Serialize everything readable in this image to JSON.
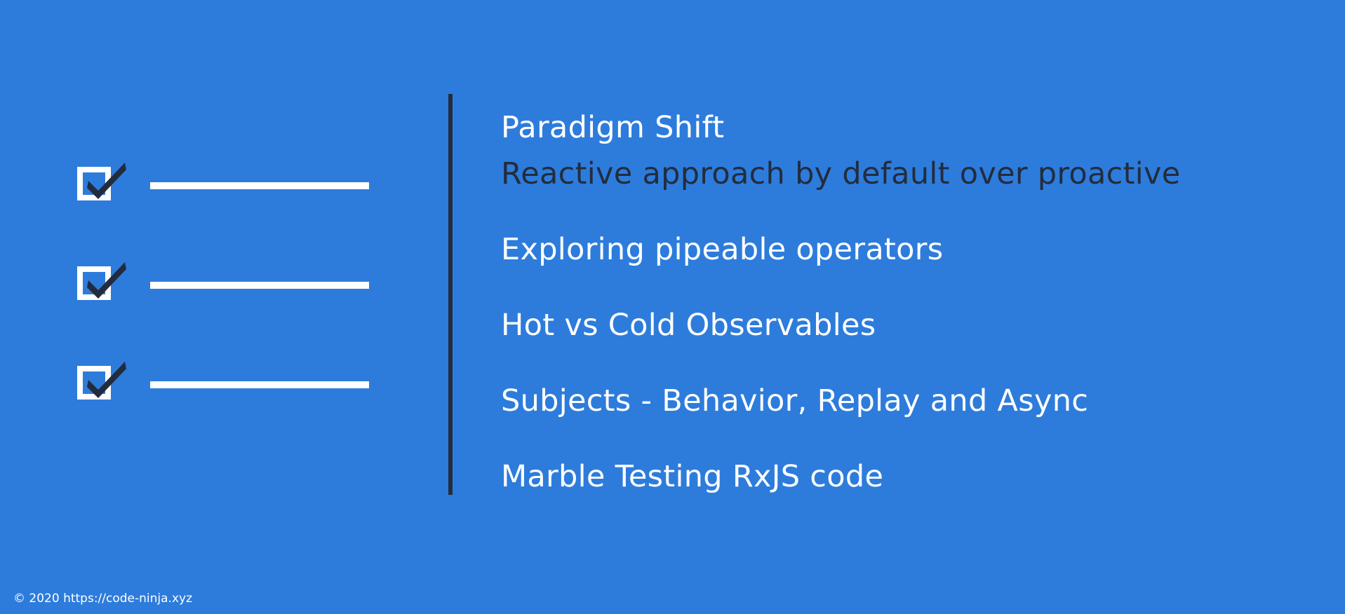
{
  "slide": {
    "topics": [
      {
        "title": "Paradigm Shift",
        "subtitle": "Reactive approach by default over proactive"
      },
      {
        "title": "Exploring pipeable operators"
      },
      {
        "title": "Hot vs Cold Observables"
      },
      {
        "title": "Subjects - Behavior, Replay and Async"
      },
      {
        "title": "Marble Testing RxJS code"
      }
    ],
    "footer": "© 2020  https://code-ninja.xyz"
  },
  "icons": {
    "checklist": "checklist-icon",
    "checkbox": "checked-checkbox-icon"
  },
  "colors": {
    "background": "#2d7cdc",
    "text_primary": "#ffffff",
    "text_dark": "#232c3d",
    "divider": "#232c3d",
    "checkmark": "#232c3d"
  }
}
